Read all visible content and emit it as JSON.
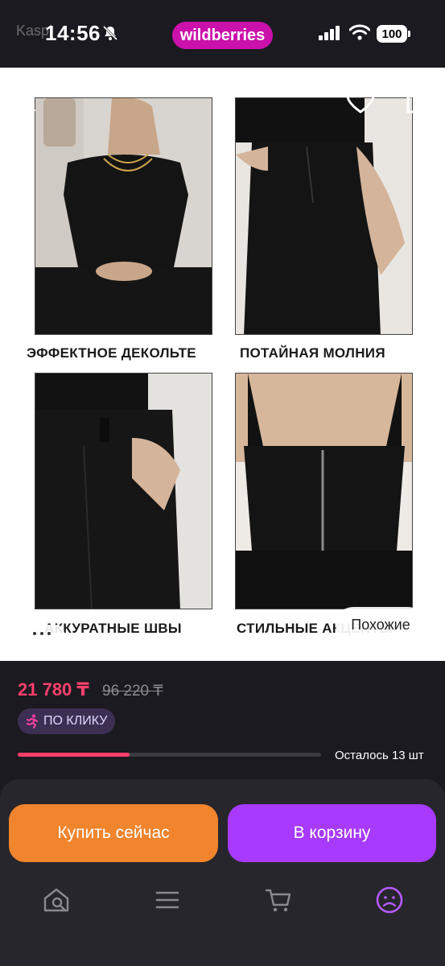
{
  "status_bar": {
    "time": "14:56",
    "watermark": "Kaspi",
    "brand": "wildberries",
    "battery": "100"
  },
  "gallery": {
    "captions": [
      "ЭФФЕКТНОЕ ДЕКОЛЬТЕ",
      "ПОТАЙНАЯ МОЛНИЯ",
      "АККУРАТНЫЕ ШВЫ",
      "СТИЛЬНЫЕ АКЦЕНТЫ"
    ],
    "similar_label": "Похожие"
  },
  "price": {
    "current": "21 780 ₸",
    "old": "96 220 ₸",
    "promo_label": "ПО КЛИКУ",
    "stock_text": "Осталось 13 шт",
    "stock_progress": 0.37
  },
  "actions": {
    "buy_now": "Купить сейчас",
    "add_to_cart": "В корзину"
  },
  "tabbar": {
    "items": [
      "home-search",
      "catalog",
      "cart",
      "profile"
    ],
    "active": "profile"
  },
  "colors": {
    "brand": "#cb11ab",
    "price": "#ff3f6c",
    "buy": "#f0852d",
    "cart": "#a73afd"
  }
}
